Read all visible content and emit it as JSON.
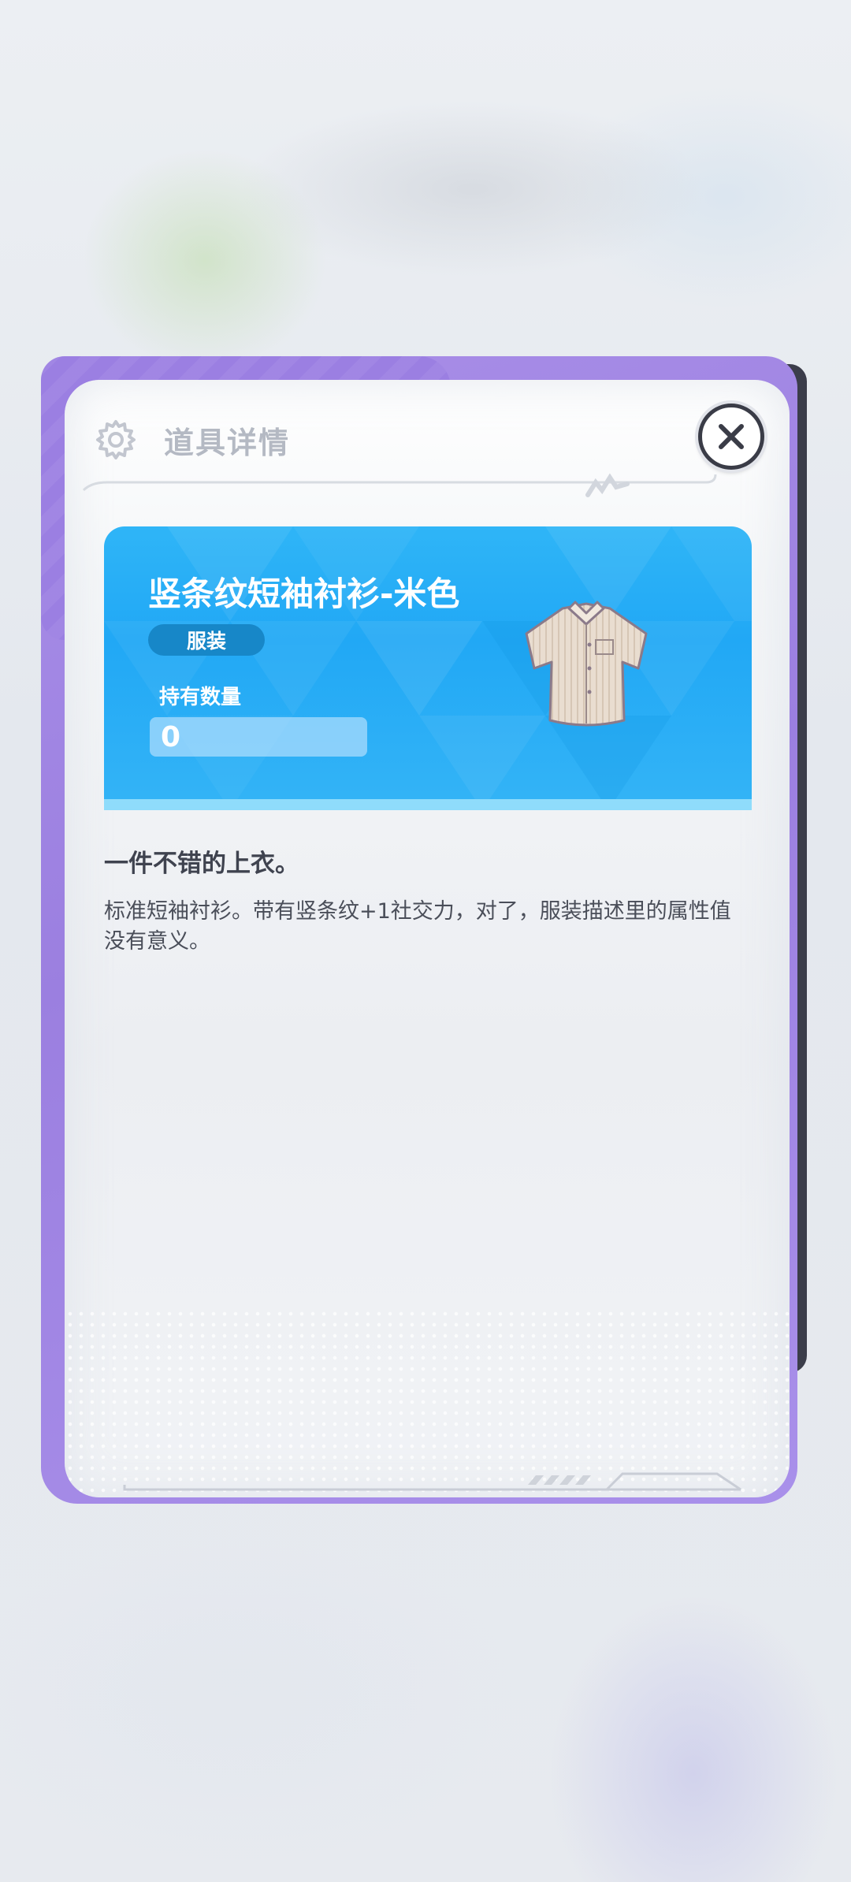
{
  "header": {
    "title": "道具详情",
    "icon": "gear-icon",
    "close_icon": "close-icon"
  },
  "item": {
    "name": "竖条纹短袖衬衫-米色",
    "category": "服装",
    "quantity_label": "持有数量",
    "quantity": "0",
    "image": "beige-striped-shirt"
  },
  "description": {
    "title": "一件不错的上衣。",
    "body": "标准短袖衬衫。带有竖条纹+1社交力，对了，服装描述里的属性值没有意义。"
  },
  "colors": {
    "frame_purple": "#9b7fe2",
    "banner_blue": "#21a8f5",
    "close_border": "#3a3c47"
  }
}
